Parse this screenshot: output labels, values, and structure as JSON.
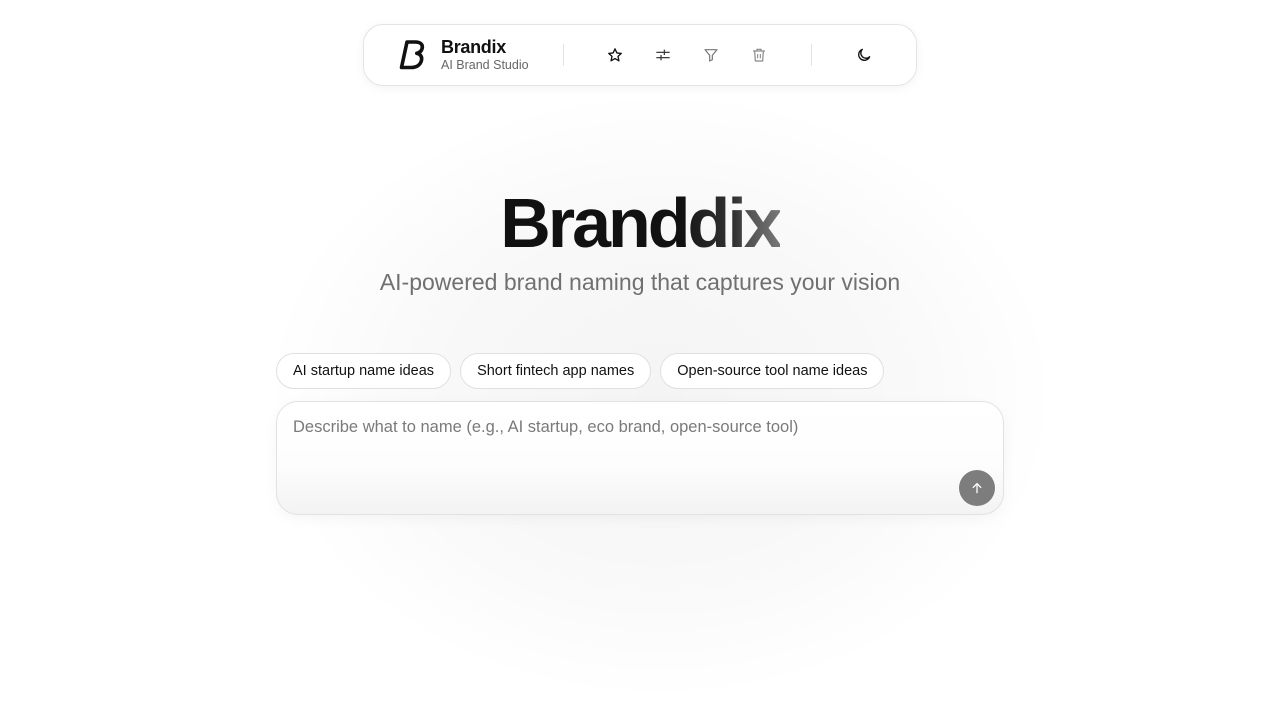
{
  "header": {
    "brand_name": "Brandix",
    "brand_subtitle": "AI Brand Studio",
    "logo_icon": "brand-b-logo",
    "tools": [
      {
        "name": "favorites",
        "icon": "star-icon"
      },
      {
        "name": "settings",
        "icon": "sliders-icon"
      },
      {
        "name": "filter",
        "icon": "filter-icon"
      },
      {
        "name": "clear",
        "icon": "trash-icon"
      }
    ],
    "theme_icon": "moon-icon"
  },
  "hero": {
    "title_part1": "Brand",
    "title_part2": "ix",
    "title_part2_lead": "d",
    "subtitle": "AI-powered brand naming that captures your vision"
  },
  "suggestions": [
    "AI startup name ideas",
    "Short fintech app names",
    "Open-source tool name ideas"
  ],
  "composer": {
    "placeholder": "Describe what to name (e.g., AI startup, eco brand, open-source tool)",
    "value": "",
    "send_icon": "arrow-up-icon"
  },
  "colors": {
    "background": "#ffffff",
    "text": "#111111",
    "muted": "#707070",
    "send_button": "#7d7d7d"
  }
}
